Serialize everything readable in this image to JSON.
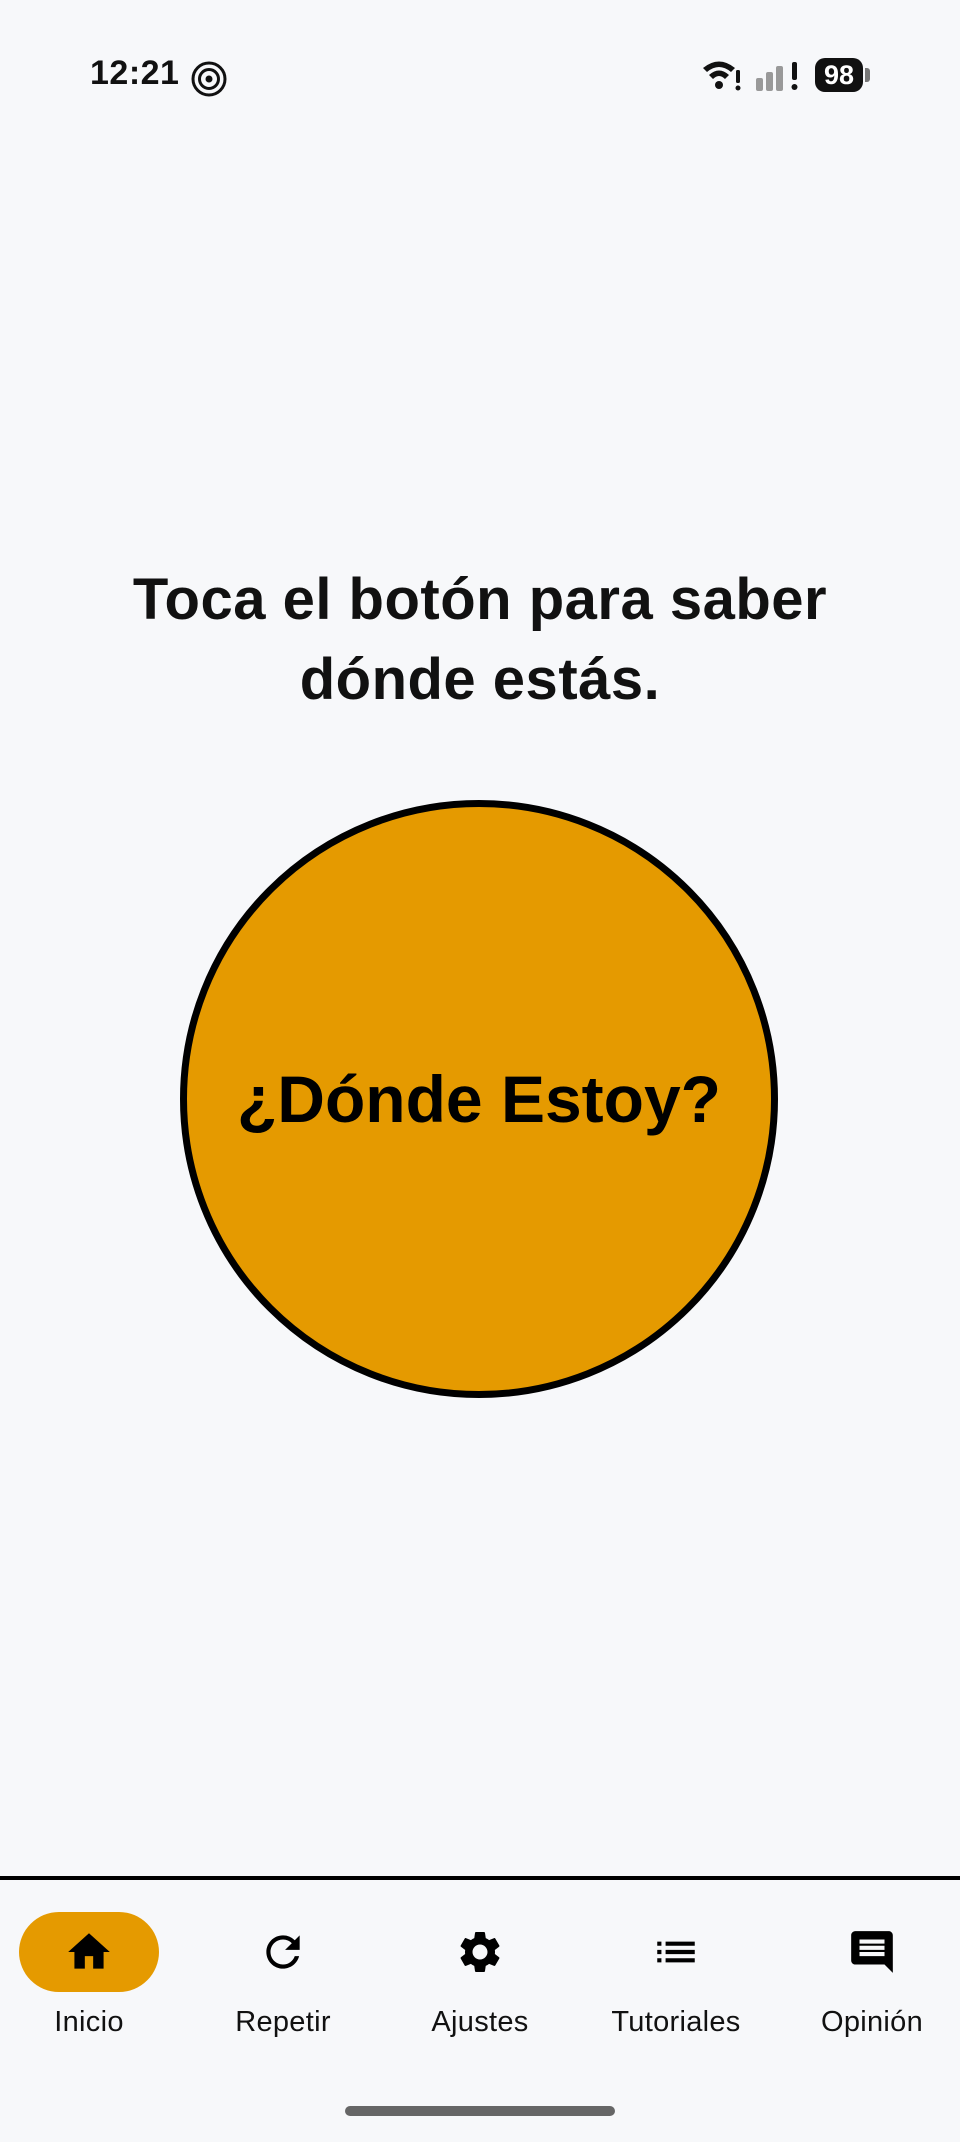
{
  "status_bar": {
    "time": "12:21",
    "battery": "98",
    "icons": [
      "radar-app-icon",
      "wifi-icon",
      "signal-icon",
      "battery-icon"
    ]
  },
  "main": {
    "prompt_line1": "Toca el botón para saber",
    "prompt_line2": "dónde estás.",
    "button_label": "¿Dónde Estoy?",
    "button_color": "#e59a00"
  },
  "nav": {
    "items": [
      {
        "label": "Inicio",
        "icon": "home-icon",
        "active": true
      },
      {
        "label": "Repetir",
        "icon": "refresh-icon",
        "active": false
      },
      {
        "label": "Ajustes",
        "icon": "gear-icon",
        "active": false
      },
      {
        "label": "Tutoriales",
        "icon": "list-icon",
        "active": false
      },
      {
        "label": "Opinión",
        "icon": "feedback-icon",
        "active": false
      }
    ]
  }
}
